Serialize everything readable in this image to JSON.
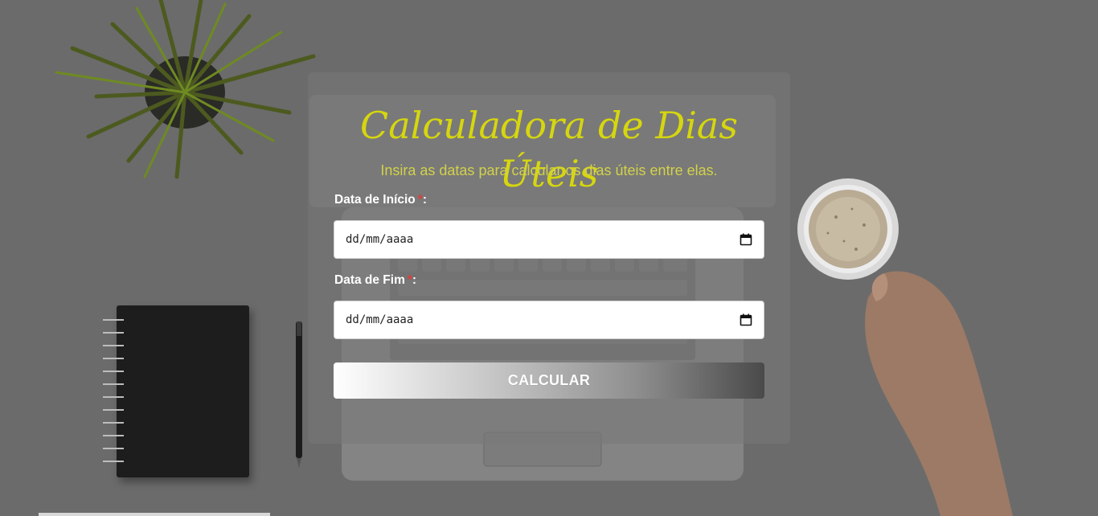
{
  "form": {
    "title": "Calculadora de Dias Úteis",
    "subtitle": "Insira as datas para calcular os dias úteis entre elas.",
    "start_label": "Data de Início",
    "start_required": "*",
    "start_colon": ":",
    "start_value": "dd/mm/aaaa",
    "end_label": "Data de Fim",
    "end_required": "*",
    "end_colon": ":",
    "end_value": "dd/mm/aaaa",
    "button_label": "CALCULAR"
  },
  "colors": {
    "title": "#d6d60f",
    "subtitle": "#d2d14a",
    "required": "#e23b3b",
    "card_bg": "rgba(120,120,120,0.55)"
  },
  "icons": {
    "date_picker": "calendar-icon"
  }
}
